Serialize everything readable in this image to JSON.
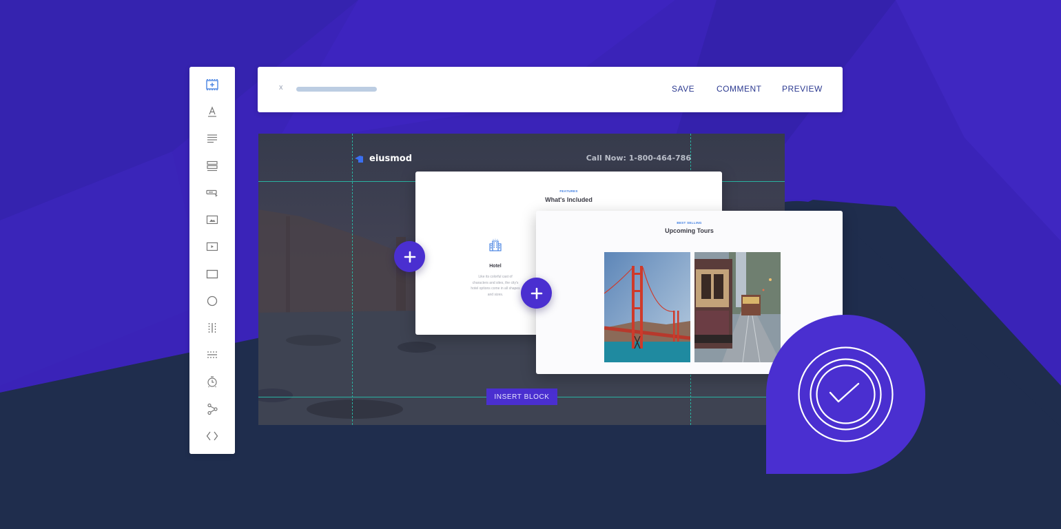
{
  "colors": {
    "brand_purple": "#4a2fd0",
    "nav_text": "#2b3990",
    "guide_teal": "#2ab3a2",
    "bg_navy": "#1f2d4d",
    "bg_purple": "#3a23b8"
  },
  "toolbar": {
    "tools": [
      {
        "icon": "add-section-icon",
        "active": true
      },
      {
        "icon": "heading-icon"
      },
      {
        "icon": "paragraph-icon"
      },
      {
        "icon": "rows-icon"
      },
      {
        "icon": "button-icon"
      },
      {
        "icon": "image-icon"
      },
      {
        "icon": "video-icon"
      },
      {
        "icon": "box-icon"
      },
      {
        "icon": "circle-icon"
      },
      {
        "icon": "column-divider-icon"
      },
      {
        "icon": "row-divider-icon"
      },
      {
        "icon": "timer-icon"
      },
      {
        "icon": "share-icon"
      },
      {
        "icon": "code-icon"
      }
    ]
  },
  "topbar": {
    "close_label": "x",
    "actions": {
      "save": "SAVE",
      "comment": "COMMENT",
      "preview": "PREVIEW"
    }
  },
  "canvas": {
    "site_name": "eiusmod",
    "call_now": "Call Now: 1-800-464-786",
    "insert_block_label": "INSERT BLOCK"
  },
  "features_card": {
    "eyebrow": "FEATURES",
    "title": "What's Included",
    "item": {
      "icon": "hotel-icon",
      "title": "Hotel",
      "description": "Like its colorful cast of characters and sites, the city's hotel options come in all shapes and sizes."
    }
  },
  "tours_card": {
    "eyebrow": "BEST SELLING",
    "title": "Upcoming Tours",
    "images": [
      "golden-gate-bridge",
      "cable-car"
    ]
  },
  "add_buttons": [
    "add-block-left",
    "add-block-center"
  ],
  "badge": {
    "icon": "checkmark-icon",
    "state": "verified"
  }
}
